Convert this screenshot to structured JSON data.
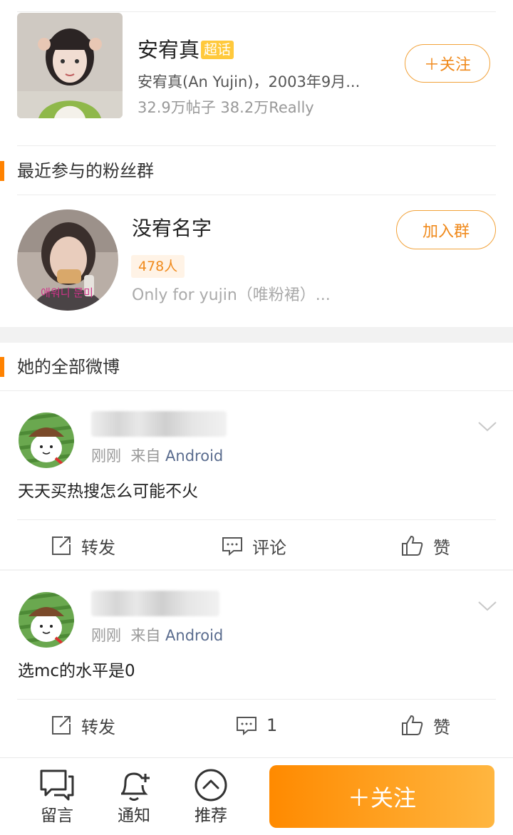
{
  "topic": {
    "title": "安宥真",
    "badge": "超话",
    "description": "安宥真(An Yujin)，2003年9月...",
    "stats": "32.9万帖子 38.2万Really",
    "follow_label": "＋关注"
  },
  "fan_groups_section": {
    "title": "最近参与的粉丝群"
  },
  "fan_group": {
    "name": "没宥名字",
    "member_count": "478人",
    "description": "Only for yujin（唯粉裙）...",
    "join_label": "加入群",
    "avatar_caption": "애워니 문미"
  },
  "posts_section": {
    "title": "她的全部微博"
  },
  "posts": [
    {
      "time": "刚刚",
      "from_label": "来自",
      "source": "Android",
      "text": "天天买热搜怎么可能不火",
      "repost_label": "转发",
      "comment_label": "评论",
      "like_label": "赞"
    },
    {
      "time": "刚刚",
      "from_label": "来自",
      "source": "Android",
      "text": "选mc的水平是0",
      "repost_label": "转发",
      "comment_label": "1",
      "like_label": "赞"
    }
  ],
  "bottom_bar": {
    "message_label": "留言",
    "notify_label": "通知",
    "recommend_label": "推荐",
    "follow_label": "＋关注"
  },
  "colors": {
    "accent": "#ff8200",
    "link": "#5a6c8e"
  }
}
